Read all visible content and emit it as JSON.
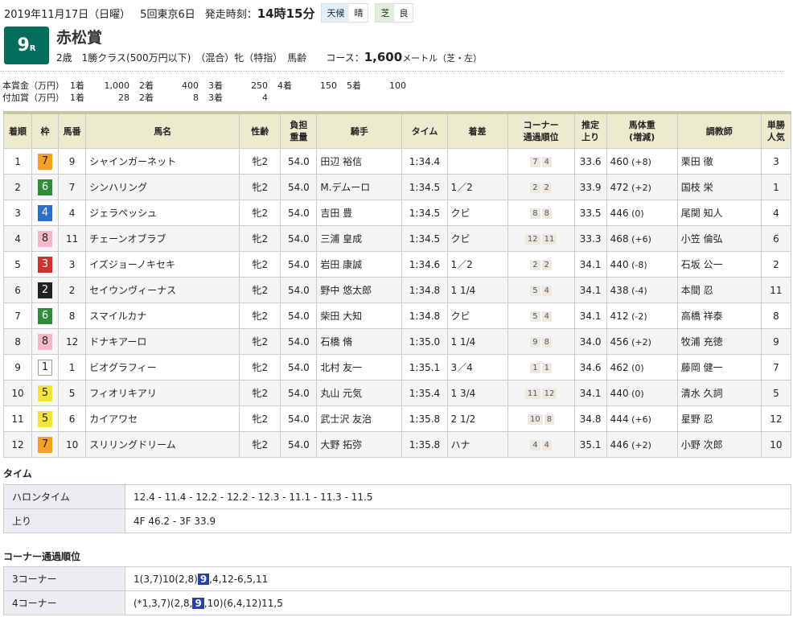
{
  "header": {
    "date": "2019年11月17日（日曜）",
    "meeting": "5回東京6日",
    "start_label": "発走時刻：",
    "start_time": "14時15分",
    "weather_label": "天候",
    "weather": "晴",
    "surface_label": "芝",
    "going": "良"
  },
  "race": {
    "number": "9",
    "suffix": "R",
    "name": "赤松賞",
    "conditions": "2歳　1勝クラス(500万円以下)　（混合）牝（特指）　馬齢",
    "course_label": "コース：",
    "distance": "1,600",
    "unit": "メートル（芝・左）",
    "brand_color": "#006e5a"
  },
  "prize": {
    "main_label": "本賞金（万円）",
    "main": [
      [
        "1着",
        "1,000"
      ],
      [
        "2着",
        "400"
      ],
      [
        "3着",
        "250"
      ],
      [
        "4着",
        "150"
      ],
      [
        "5着",
        "100"
      ]
    ],
    "add_label": "付加賞（万円）",
    "add": [
      [
        "1着",
        "28"
      ],
      [
        "2着",
        "8"
      ],
      [
        "3着",
        "4"
      ]
    ]
  },
  "table": {
    "headers": [
      "着順",
      "枠",
      "馬番",
      "馬名",
      "性齢",
      "負担\n重量",
      "騎手",
      "タイム",
      "着差",
      "コーナー\n通過順位",
      "推定\n上り",
      "馬体重\n(増減)",
      "調教師",
      "単勝\n人気"
    ],
    "rows": [
      [
        "1",
        "7",
        "9",
        "シャインガーネット",
        "牝2",
        "54.0",
        "田辺 裕信",
        "1:34.4",
        "",
        [
          "7",
          "4"
        ],
        "33.6",
        "460",
        "(+8)",
        "栗田 徹",
        "3"
      ],
      [
        "2",
        "6",
        "7",
        "シンハリング",
        "牝2",
        "54.0",
        "M.デムーロ",
        "1:34.5",
        "1／2",
        [
          "2",
          "2"
        ],
        "33.9",
        "472",
        "(+2)",
        "国枝 栄",
        "1"
      ],
      [
        "3",
        "4",
        "4",
        "ジェラペッシュ",
        "牝2",
        "54.0",
        "吉田 豊",
        "1:34.5",
        "クビ",
        [
          "8",
          "8"
        ],
        "33.5",
        "446",
        "(0)",
        "尾関 知人",
        "4"
      ],
      [
        "4",
        "8",
        "11",
        "チェーンオブラブ",
        "牝2",
        "54.0",
        "三浦 皇成",
        "1:34.5",
        "クビ",
        [
          "12",
          "11"
        ],
        "33.3",
        "468",
        "(+6)",
        "小笠 倫弘",
        "6"
      ],
      [
        "5",
        "3",
        "3",
        "イズジョーノキセキ",
        "牝2",
        "54.0",
        "岩田 康誠",
        "1:34.6",
        "1／2",
        [
          "2",
          "2"
        ],
        "34.1",
        "440",
        "(-8)",
        "石坂 公一",
        "2"
      ],
      [
        "6",
        "2",
        "2",
        "セイウンヴィーナス",
        "牝2",
        "54.0",
        "野中 悠太郎",
        "1:34.8",
        "1 1/4",
        [
          "5",
          "4"
        ],
        "34.1",
        "438",
        "(-4)",
        "本間 忍",
        "11"
      ],
      [
        "7",
        "6",
        "8",
        "スマイルカナ",
        "牝2",
        "54.0",
        "柴田 大知",
        "1:34.8",
        "クビ",
        [
          "5",
          "4"
        ],
        "34.1",
        "412",
        "(-2)",
        "高橋 祥泰",
        "8"
      ],
      [
        "8",
        "8",
        "12",
        "ドナキアーロ",
        "牝2",
        "54.0",
        "石橋 脩",
        "1:35.0",
        "1 1/4",
        [
          "9",
          "8"
        ],
        "34.0",
        "456",
        "(+2)",
        "牧浦 充徳",
        "9"
      ],
      [
        "9",
        "1",
        "1",
        "ビオグラフィー",
        "牝2",
        "54.0",
        "北村 友一",
        "1:35.1",
        "3／4",
        [
          "1",
          "1"
        ],
        "34.6",
        "462",
        "(0)",
        "藤岡 健一",
        "7"
      ],
      [
        "10",
        "5",
        "5",
        "フィオリキアリ",
        "牝2",
        "54.0",
        "丸山 元気",
        "1:35.4",
        "1 3/4",
        [
          "11",
          "12"
        ],
        "34.1",
        "440",
        "(0)",
        "清水 久詞",
        "5"
      ],
      [
        "11",
        "5",
        "6",
        "カイアワセ",
        "牝2",
        "54.0",
        "武士沢 友治",
        "1:35.8",
        "2 1/2",
        [
          "10",
          "8"
        ],
        "34.8",
        "444",
        "(+6)",
        "星野 忍",
        "12"
      ],
      [
        "12",
        "7",
        "10",
        "スリリングドリーム",
        "牝2",
        "54.0",
        "大野 拓弥",
        "1:35.8",
        "ハナ",
        [
          "4",
          "4"
        ],
        "35.1",
        "446",
        "(+2)",
        "小野 次郎",
        "10"
      ]
    ]
  },
  "waku_colors": {
    "1": [
      "#ffffff",
      "#222",
      "#999"
    ],
    "2": [
      "#222222",
      "#fff",
      "#222"
    ],
    "3": [
      "#d0302a",
      "#fff",
      "#d0302a"
    ],
    "4": [
      "#2a6fc9",
      "#fff",
      "#2a6fc9"
    ],
    "5": [
      "#f5e23a",
      "#222",
      "#f5e23a"
    ],
    "6": [
      "#2f8a3a",
      "#fff",
      "#2f8a3a"
    ],
    "7": [
      "#f5a020",
      "#222",
      "#f5a020"
    ],
    "8": [
      "#f6b6c8",
      "#222",
      "#f6b6c8"
    ]
  },
  "time": {
    "title": "タイム",
    "furlong_label": "ハロンタイム",
    "furlong": "12.4 - 11.4 - 12.2 - 12.2 - 12.3 - 11.1 - 11.3 - 11.5",
    "last_label": "上り",
    "last": "4F 46.2 - 3F 33.9"
  },
  "corners": {
    "title": "コーナー通過順位",
    "c3_label": "3コーナー",
    "c3": [
      "1(3,7)10(2,8)",
      "9",
      ",4,12-6,5,11"
    ],
    "c4_label": "4コーナー",
    "c4": [
      "(*1,3,7)(2,8,",
      "9",
      ",10)(6,4,12)11,5"
    ],
    "highlight_color": "#2b3fa8"
  }
}
